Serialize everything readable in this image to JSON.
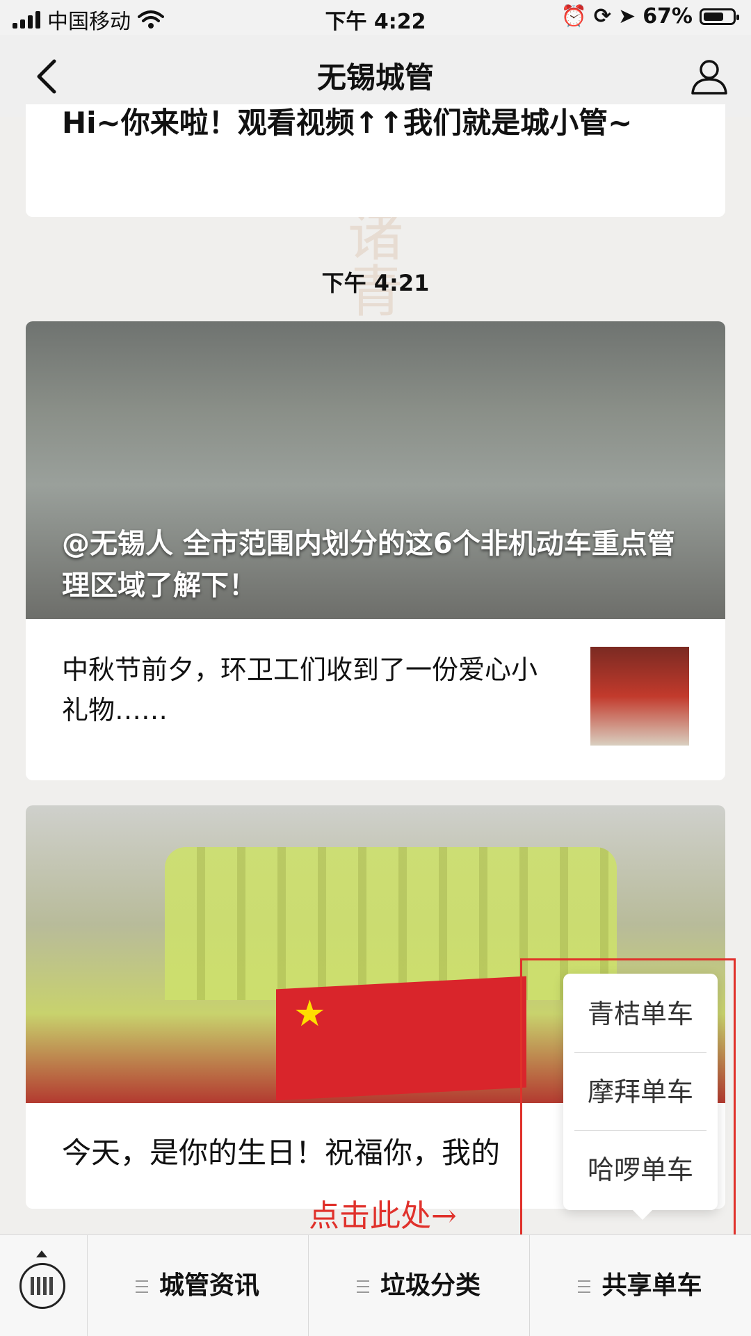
{
  "status_bar": {
    "carrier": "中国移动",
    "time": "下午 4:22",
    "battery": "67%"
  },
  "navbar": {
    "title": "无锡城管"
  },
  "chat": {
    "top_message": "Hi~你来啦！观看视频↑↑我们就是城小管~",
    "timestamp": "下午 4:21",
    "article1": {
      "headline": "@无锡人 全市范围内划分的这6个非机动车重点管理区域了解下！",
      "sub_title": "中秋节前夕，环卫工们收到了一份爱心小礼物……"
    },
    "article2": {
      "title": "今天，是你的生日！祝福你，我的"
    }
  },
  "popup_menu": {
    "items": [
      "青桔单车",
      "摩拜单车",
      "哈啰单车"
    ]
  },
  "hint_text": "点击此处→",
  "bottom_menu": {
    "items": [
      "城管资讯",
      "垃圾分类",
      "共享单车"
    ]
  }
}
